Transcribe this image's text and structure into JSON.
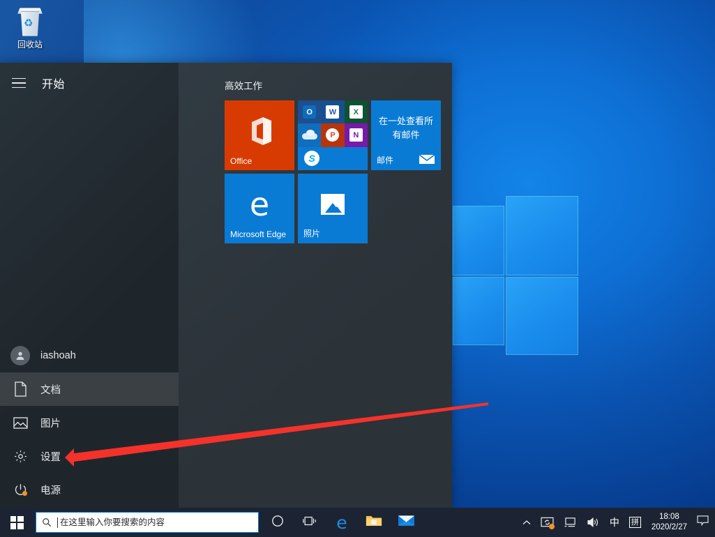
{
  "desktop": {
    "icons": [
      {
        "name": "recycle-bin",
        "label": "回收站"
      }
    ]
  },
  "start_menu": {
    "title": "开始",
    "hamburger_icon": "hamburger-menu-icon",
    "user": {
      "name": "iashoah",
      "icon": "user-avatar-icon"
    },
    "left_items": [
      {
        "label": "文档",
        "icon": "document-icon",
        "active": true
      },
      {
        "label": "图片",
        "icon": "picture-icon",
        "active": false
      },
      {
        "label": "设置",
        "icon": "gear-icon",
        "active": false
      },
      {
        "label": "电源",
        "icon": "power-icon",
        "active": false
      }
    ],
    "tile_group": {
      "title": "高效工作",
      "tiles": [
        {
          "name": "Office",
          "label": "Office",
          "color": "#d83b01"
        },
        {
          "name": "office-apps",
          "label": "",
          "color": "#0a7bd4",
          "apps": [
            "Outlook",
            "Word",
            "Excel",
            "OneDrive",
            "PowerPoint",
            "OneNote",
            "Skype"
          ]
        },
        {
          "name": "Mail",
          "label": "邮件",
          "headline": "在一处查看所有邮件",
          "color": "#0a7bd4"
        },
        {
          "name": "Microsoft Edge",
          "label": "Microsoft Edge",
          "color": "#0a7bd4"
        },
        {
          "name": "Photos",
          "label": "照片",
          "color": "#0a7bd4"
        }
      ]
    }
  },
  "taskbar": {
    "start_button": "windows-start-icon",
    "search": {
      "placeholder": "在这里输入你要搜索的内容",
      "icon": "search-icon"
    },
    "buttons": [
      {
        "name": "cortana",
        "icon": "cortana-circle-icon"
      },
      {
        "name": "task-view",
        "icon": "task-view-icon"
      },
      {
        "name": "microsoft-edge",
        "icon": "edge-icon"
      },
      {
        "name": "file-explorer",
        "icon": "folder-icon"
      },
      {
        "name": "mail",
        "icon": "envelope-icon"
      }
    ],
    "tray": {
      "show_hidden_icon": "chevron-up-icon",
      "items": [
        {
          "name": "safety-sync",
          "icon": "sync-icon",
          "badge": true
        },
        {
          "name": "network",
          "icon": "network-icon"
        },
        {
          "name": "volume",
          "icon": "speaker-icon"
        },
        {
          "name": "ime-mode",
          "label": "中"
        },
        {
          "name": "ime-pinyin",
          "label": "拼"
        }
      ],
      "clock": {
        "time": "18:08",
        "date": "2020/2/27"
      },
      "notification_icon": "notification-bubble-icon"
    }
  },
  "annotation": {
    "arrow_color": "#f5322a",
    "points_to": "设置"
  }
}
